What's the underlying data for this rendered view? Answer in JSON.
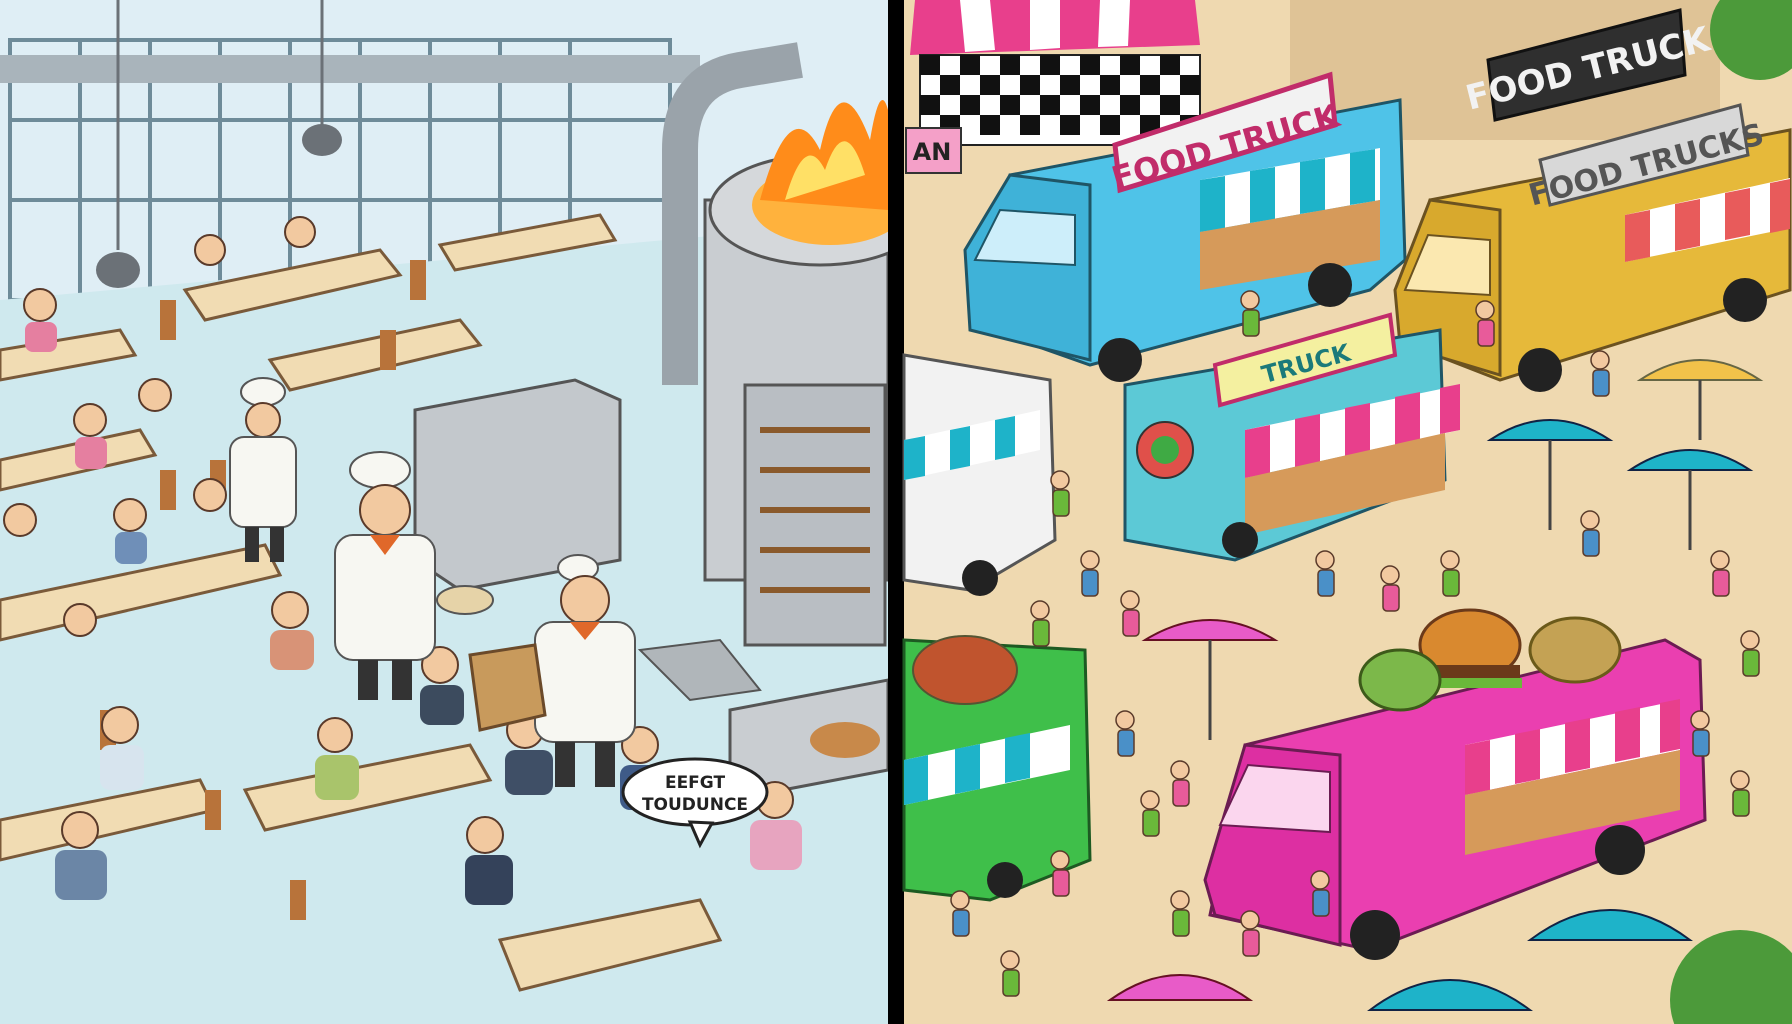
{
  "panels": {
    "left": {
      "speech_bubble": {
        "line1": "EEFGT",
        "line2": "TOUDUNCE"
      }
    },
    "right": {
      "signs": {
        "banner_top_left": "AN",
        "blue_truck": "FOOD TRUCK",
        "top_right": "FOOD TRUCK",
        "yellow_truck": "FOOD TRUCKS",
        "center_truck": "TRUCK"
      }
    }
  },
  "colors": {
    "divider": "#000000",
    "kitchen_floor": "#cfe9ee",
    "kitchen_wall": "#dfeef5",
    "chef_white": "#f7f7f2",
    "oven_steel": "#c9cdd1",
    "fire": "#ff8c1a",
    "blue_truck": "#4fc3e8",
    "yellow_truck": "#e6b93a",
    "pink_truck": "#ea3fb0",
    "cyan_truck": "#5cc9d6",
    "green_truck": "#3fbf4a",
    "ground": "#efd9b0",
    "umbrella_teal": "#1eb3c9",
    "umbrella_pink": "#e85bc8"
  }
}
